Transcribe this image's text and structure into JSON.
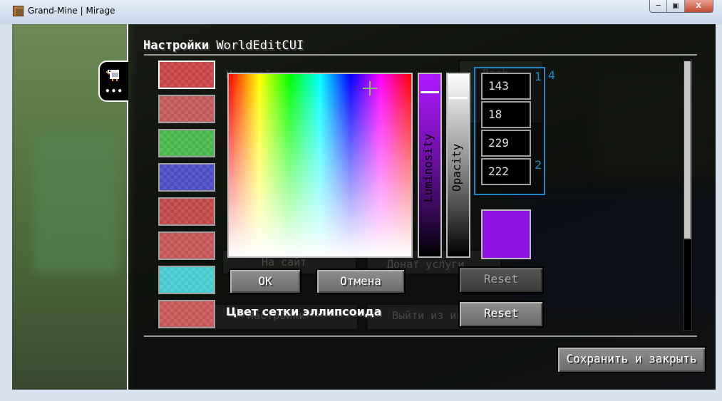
{
  "window": {
    "title": "Grand-Mine | Mirage",
    "controls": {
      "minimize": "─",
      "restore": "▣",
      "close": "X"
    }
  },
  "screen": {
    "title_bold": "Настройки",
    "title_rest": " WorldEditCUI",
    "list_item_label": "Цвет сетки эллипсоида"
  },
  "swatches": [
    {
      "name": "swatch-1",
      "color": "#c74242",
      "selected": true
    },
    {
      "name": "swatch-2",
      "color": "#c05858",
      "selected": false
    },
    {
      "name": "swatch-3",
      "color": "#47b44a",
      "selected": false
    },
    {
      "name": "swatch-4",
      "color": "#4a4ac2",
      "selected": false
    },
    {
      "name": "swatch-5",
      "color": "#c04646",
      "selected": false
    },
    {
      "name": "swatch-6",
      "color": "#c45454",
      "selected": false
    },
    {
      "name": "swatch-7",
      "color": "#45c9cc",
      "selected": false
    },
    {
      "name": "swatch-8",
      "color": "#c45555",
      "selected": false
    }
  ],
  "picker": {
    "luminosity_label": "Luminosity",
    "opacity_label": "Opacity",
    "ok_label": "OK",
    "cancel_label": "Отмена",
    "preview_color": "#8f12e5"
  },
  "rgba": {
    "r": "143",
    "g": "18",
    "b": "229",
    "a": "222",
    "annotations": {
      "top_left": "1",
      "top_right": "4",
      "bottom": "2"
    }
  },
  "reset_buttons": [
    {
      "label": "Reset",
      "active": false
    },
    {
      "label": "Reset",
      "active": true
    }
  ],
  "footer": {
    "save_close_label": "Сохранить и закрыть"
  }
}
